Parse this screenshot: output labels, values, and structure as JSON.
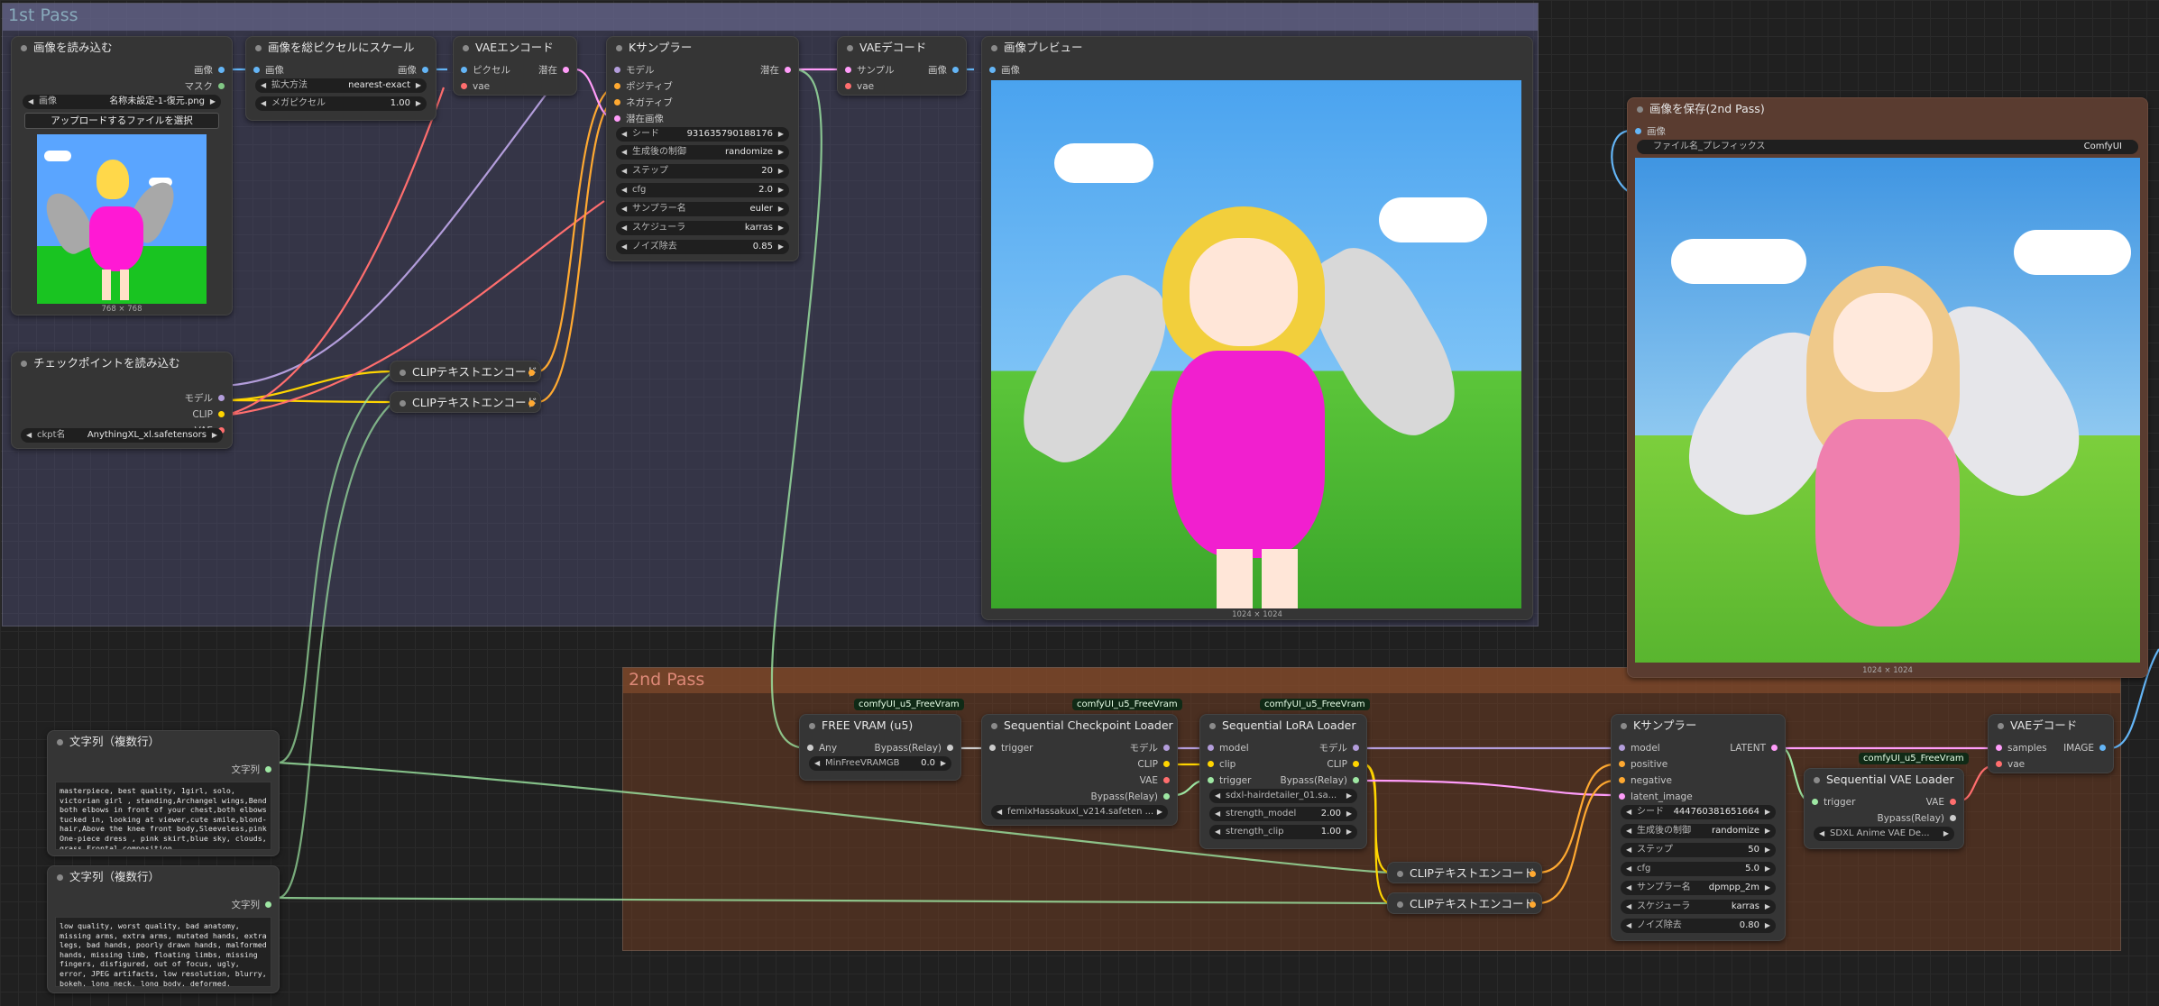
{
  "groups": {
    "pass1": "1st Pass",
    "pass2": "2nd Pass"
  },
  "load_image": {
    "title": "画像を読み込む",
    "out_image": "画像",
    "out_mask": "マスク",
    "image_label": "画像",
    "image_value": "名称未設定-1-復元.png",
    "upload_button": "アップロードするファイルを選択",
    "size": "768 × 768"
  },
  "scale": {
    "title": "画像を総ピクセルにスケール",
    "in_image": "画像",
    "out_image": "画像",
    "method_label": "拡大方法",
    "method_value": "nearest-exact",
    "mp_label": "メガピクセル",
    "mp_value": "1.00"
  },
  "vae_encode": {
    "title": "VAEエンコード",
    "in_pixels": "ピクセル",
    "in_vae": "vae",
    "out_latent": "潜在"
  },
  "ksampler1": {
    "title": "Kサンプラー",
    "in_model": "モデル",
    "in_positive": "ポジティブ",
    "in_negative": "ネガティブ",
    "in_latent": "潜在画像",
    "out_latent": "潜在",
    "widgets": [
      {
        "label": "シード",
        "value": "931635790188176"
      },
      {
        "label": "生成後の制御",
        "value": "randomize"
      },
      {
        "label": "ステップ",
        "value": "20"
      },
      {
        "label": "cfg",
        "value": "2.0"
      },
      {
        "label": "サンプラー名",
        "value": "euler"
      },
      {
        "label": "スケジューラ",
        "value": "karras"
      },
      {
        "label": "ノイズ除去",
        "value": "0.85"
      }
    ]
  },
  "vae_decode1": {
    "title": "VAEデコード",
    "in_samples": "サンプル",
    "in_vae": "vae",
    "out_image": "画像"
  },
  "preview": {
    "title": "画像プレビュー",
    "in_image": "画像",
    "size": "1024 × 1024"
  },
  "checkpoint": {
    "title": "チェックポイントを読み込む",
    "out_model": "モデル",
    "out_clip": "CLIP",
    "out_vae": "VAE",
    "ckpt_label": "ckpt名",
    "ckpt_value": "AnythingXL_xl.safetensors"
  },
  "clip_enc_1a": {
    "title": "CLIPテキストエンコード"
  },
  "clip_enc_1b": {
    "title": "CLIPテキストエンコード"
  },
  "save_image": {
    "title": "画像を保存(2nd Pass)",
    "in_image": "画像",
    "prefix_label": "ファイル名_プレフィックス",
    "prefix_value": "ComfyUI",
    "size": "1024 × 1024"
  },
  "string_pos": {
    "title": "文字列（複数行）",
    "out": "文字列",
    "text": "masterpiece, best quality, 1girl, solo, victorian girl , standing,Archangel wings,Bend both elbows in front of your chest,both elbows tucked in, looking at viewer,cute smile,blond-hair,Above the knee front body,Sleeveless,pink One-piece dress , pink skirt,blue sky, clouds, grass,Frontal composition"
  },
  "string_neg": {
    "title": "文字列（複数行）",
    "out": "文字列",
    "text": "low quality, worst quality, bad anatomy, missing arms, extra arms, mutated hands, extra legs, bad hands, poorly drawn hands, malformed hands, missing limb, floating limbs, missing fingers, disfigured, out of focus, ugly, error, JPEG artifacts, low resolution, blurry, bokeh, long neck, long body, deformed, lowres,watermark"
  },
  "free_vram": {
    "badge": "comfyUI_u5_FreeVram",
    "title": "FREE VRAM (u5)",
    "in_any": "Any",
    "out_bypass": "Bypass(Relay)",
    "widget_label": "MinFreeVRAMGB",
    "widget_value": "0.0"
  },
  "seq_ckpt": {
    "badge": "comfyUI_u5_FreeVram",
    "title": "Sequential Checkpoint Loader",
    "in_trigger": "trigger",
    "out_model": "モデル",
    "out_clip": "CLIP",
    "out_vae": "VAE",
    "out_bypass": "Bypass(Relay)",
    "ckpt_value": "femixHassakuxl_v214.safeten ..."
  },
  "seq_lora": {
    "badge": "comfyUI_u5_FreeVram",
    "title": "Sequential LoRA Loader",
    "in_model": "model",
    "in_clip": "clip",
    "in_trigger": "trigger",
    "out_model": "モデル",
    "out_clip": "CLIP",
    "out_bypass": "Bypass(Relay)",
    "lora_value": "sdxl-hairdetailer_01.sa...",
    "sm_label": "strength_model",
    "sm_value": "2.00",
    "sc_label": "strength_clip",
    "sc_value": "1.00"
  },
  "clip_enc_2a": {
    "title": "CLIPテキストエンコード"
  },
  "clip_enc_2b": {
    "title": "CLIPテキストエンコード"
  },
  "ksampler2": {
    "title": "Kサンプラー",
    "in_model": "model",
    "in_positive": "positive",
    "in_negative": "negative",
    "in_latent": "latent_image",
    "out_latent": "LATENT",
    "widgets": [
      {
        "label": "シード",
        "value": "444760381651664"
      },
      {
        "label": "生成後の制御",
        "value": "randomize"
      },
      {
        "label": "ステップ",
        "value": "50"
      },
      {
        "label": "cfg",
        "value": "5.0"
      },
      {
        "label": "サンプラー名",
        "value": "dpmpp_2m"
      },
      {
        "label": "スケジューラ",
        "value": "karras"
      },
      {
        "label": "ノイズ除去",
        "value": "0.80"
      }
    ]
  },
  "seq_vae": {
    "badge": "comfyUI_u5_FreeVram",
    "title": "Sequential VAE Loader",
    "in_trigger": "trigger",
    "out_vae": "VAE",
    "out_bypass": "Bypass(Relay)",
    "vae_value": "SDXL Anime VAE De..."
  },
  "vae_decode2": {
    "title": "VAEデコード",
    "in_samples": "samples",
    "in_vae": "vae",
    "out_image": "IMAGE"
  },
  "colors": {
    "image": "#64b5f6",
    "model": "#b39ddb",
    "clip": "#ffd500",
    "vae": "#ff6e6e",
    "conditioning": "#ffa931",
    "latent": "#ff9cf9",
    "string": "#9ee7a3",
    "group1": "#3f3f5a",
    "group2": "#5a3a2a"
  }
}
